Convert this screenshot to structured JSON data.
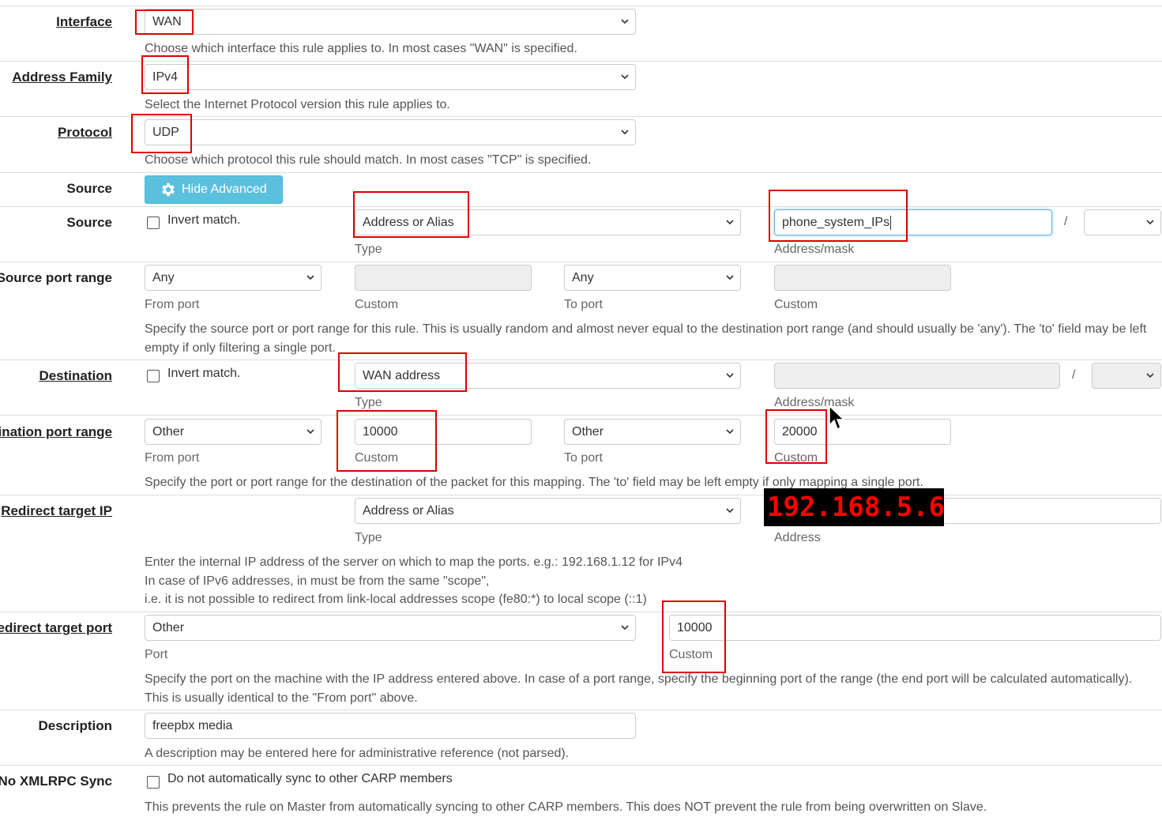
{
  "interface": {
    "label": "Interface",
    "value": "WAN",
    "help": "Choose which interface this rule applies to. In most cases \"WAN\" is specified."
  },
  "address_family": {
    "label": "Address Family",
    "value": "IPv4",
    "help": "Select the Internet Protocol version this rule applies to."
  },
  "protocol": {
    "label": "Protocol",
    "value": "UDP",
    "help": "Choose which protocol this rule should match. In most cases \"TCP\" is specified."
  },
  "source_advanced": {
    "label": "Source",
    "button_label": "Hide Advanced"
  },
  "source": {
    "label": "Source",
    "invert_label": "Invert match.",
    "type_value": "Address or Alias",
    "type_sub": "Type",
    "address_value": "phone_system_IPs",
    "address_sub": "Address/mask",
    "slash": "/"
  },
  "source_port_range": {
    "label": "Source port range",
    "from_value": "Any",
    "from_sub": "From port",
    "from_custom_sub": "Custom",
    "to_value": "Any",
    "to_sub": "To port",
    "to_custom_sub": "Custom",
    "help_line1": "Specify the source port or port range for this rule. This is usually random and almost never equal to the destination port range (and should usually be 'any'). The 'to' field may be left",
    "help_line2": "empty if only filtering a single port."
  },
  "destination": {
    "label": "Destination",
    "invert_label": "Invert match.",
    "type_value": "WAN address",
    "type_sub": "Type",
    "address_sub": "Address/mask",
    "slash": "/"
  },
  "destination_port_range": {
    "label": "ination port range",
    "from_value": "Other",
    "from_sub": "From port",
    "from_custom_value": "10000",
    "from_custom_sub": "Custom",
    "to_value": "Other",
    "to_sub": "To port",
    "to_custom_value": "20000",
    "to_custom_sub": "Custom",
    "help": "Specify the port or port range for the destination of the packet for this mapping. The 'to' field may be left empty if only mapping a single port."
  },
  "redirect_target_ip": {
    "label": "Redirect target IP",
    "type_value": "Address or Alias",
    "type_sub": "Type",
    "address_overlay": "192.168.5.6",
    "address_sub": "Address",
    "help_line1": "Enter the internal IP address of the server on which to map the ports. e.g.: 192.168.1.12 for IPv4",
    "help_line2": "In case of IPv6 addresses, in must be from the same \"scope\",",
    "help_line3": "i.e. it is not possible to redirect from link-local addresses scope (fe80:*) to local scope (::1)"
  },
  "redirect_target_port": {
    "label": "edirect target port",
    "port_value": "Other",
    "port_sub": "Port",
    "custom_value": "10000",
    "custom_sub": "Custom",
    "help_line1": "Specify the port on the machine with the IP address entered above. In case of a port range, specify the beginning port of the range (the end port will be calculated automatically).",
    "help_line2": "This is usually identical to the \"From port\" above."
  },
  "description": {
    "label": "Description",
    "value": "freepbx media",
    "help": "A description may be entered here for administrative reference (not parsed)."
  },
  "no_xmlrpc_sync": {
    "label": "No XMLRPC Sync",
    "checkbox_label": "Do not automatically sync to other CARP members",
    "help": "This prevents the rule on Master from automatically syncing to other CARP members. This does NOT prevent the rule from being overwritten on Slave."
  },
  "colors": {
    "highlight": "#e00000",
    "button": "#5bc0de",
    "ip_overlay_text": "#ff0000",
    "ip_overlay_bg": "#000000"
  },
  "icons": {
    "select": "chevron-down-icon",
    "button": "gear-icon",
    "cursor": "mouse-pointer-icon"
  }
}
